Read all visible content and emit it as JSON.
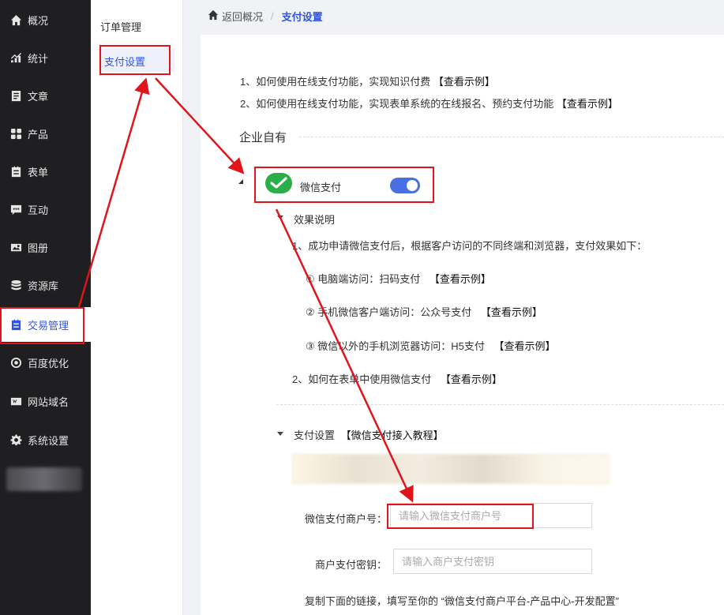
{
  "sidebar": {
    "items": [
      {
        "label": "概况",
        "icon": "home-icon"
      },
      {
        "label": "统计",
        "icon": "chart-icon"
      },
      {
        "label": "文章",
        "icon": "article-icon"
      },
      {
        "label": "产品",
        "icon": "grid-icon"
      },
      {
        "label": "表单",
        "icon": "form-icon"
      },
      {
        "label": "互动",
        "icon": "chat-icon"
      },
      {
        "label": "图册",
        "icon": "album-icon"
      },
      {
        "label": "资源库",
        "icon": "database-icon"
      },
      {
        "label": "交易管理",
        "icon": "trade-icon"
      },
      {
        "label": "百度优化",
        "icon": "seo-icon"
      },
      {
        "label": "网站域名",
        "icon": "domain-icon"
      },
      {
        "label": "系统设置",
        "icon": "gear-icon"
      }
    ]
  },
  "submenu": {
    "items": [
      "订单管理",
      "支付设置"
    ]
  },
  "breadcrumb": {
    "back": "返回概况",
    "separator": "/",
    "current": "支付设置"
  },
  "intro": {
    "line1": "1、如何使用在线支付功能，实现知识付费",
    "line1_link": "【查看示例】",
    "line2": "2、如何使用在线支付功能，实现表单系统的在线报名、预约支付功能",
    "line2_link": "【查看示例】"
  },
  "section": {
    "title": "企业自有"
  },
  "wechat_pay": {
    "label": "微信支付",
    "enabled": true,
    "effect": {
      "title": "效果说明",
      "line1": "1、成功申请微信支付后，根据客户访问的不同终端和浏览器，支付效果如下：",
      "item1": "① 电脑端访问：扫码支付",
      "item2": "② 手机微信客户端访问：公众号支付",
      "item3": "③ 微信以外的手机浏览器访问：H5支付",
      "line2": "2、如何在表单中使用微信支付",
      "example": "【查看示例】"
    },
    "settings": {
      "title": "支付设置",
      "tutorial": "【微信支付接入教程】",
      "merchant_id_label": "微信支付商户号：",
      "merchant_id_placeholder": "请输入微信支付商户号",
      "merchant_key_label": "商户支付密钥：",
      "merchant_key_placeholder": "请输入商户支付密钥",
      "copy_hint": "复制下面的链接，填写至你的 “微信支付商户平台-产品中心-开发配置”"
    }
  },
  "colors": {
    "accent": "#2f54eb",
    "sidebar_bg": "#1f1f22",
    "annotation_red": "#e0151b",
    "wechat_green": "#2aae47",
    "toggle_on": "#4a6fe3"
  }
}
